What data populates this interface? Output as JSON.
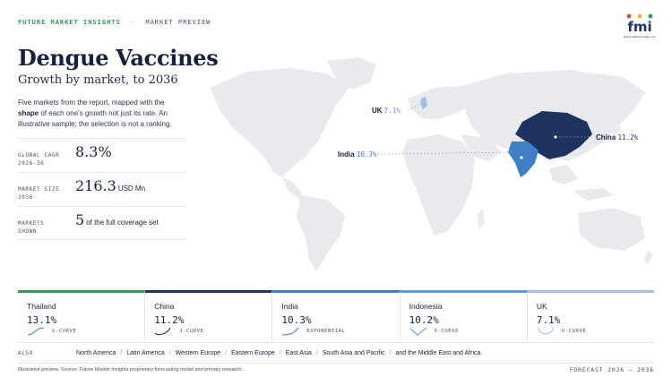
{
  "header": {
    "brand": "FUTURE MARKET INSIGHTS",
    "separator": "·",
    "section": "MARKET PREVIEW",
    "logo_text": "fmi",
    "logo_tagline": "Future Market Insights, Inc."
  },
  "title": "Dengue Vaccines",
  "subtitle": "Growth by market, to 2036",
  "intro": {
    "part1": "Five markets from the report, mapped with the ",
    "bold": "shape",
    "part2": " of each one's growth not just its rate. An illustrative sample; the selection is not a ranking."
  },
  "kpis": [
    {
      "label_line1": "GLOBAL CAGR",
      "label_line2": "2026-36",
      "value": "8.3%",
      "unit": ""
    },
    {
      "label_line1": "MARKET SIZE",
      "label_line2": "2036",
      "value": "216.3",
      "unit": "USD Mn"
    },
    {
      "label_line1": "MARKETS",
      "label_line2": "SHOWN",
      "value": "5",
      "unit": "of the full coverage set"
    }
  ],
  "map": {
    "labels": [
      {
        "country": "UK",
        "rate": "7.1%"
      },
      {
        "country": "India",
        "rate": "10.3%"
      },
      {
        "country": "China",
        "rate": "11.2%"
      }
    ],
    "colors": {
      "land": "#e8eaee",
      "china": "#1d3361",
      "india": "#3f7fc6",
      "uk": "#9dc1e8",
      "leader": "#9aa3b2"
    }
  },
  "markets": [
    {
      "name": "Thailand",
      "cagr": "13.1%",
      "curve": "S-CURVE",
      "color": "#2e9b5a"
    },
    {
      "name": "China",
      "cagr": "11.2%",
      "curve": "J-CURVE",
      "color": "#1d3361"
    },
    {
      "name": "India",
      "cagr": "10.3%",
      "curve": "EXPONENTIAL",
      "color": "#3f7fc6"
    },
    {
      "name": "Indonesia",
      "cagr": "10.2%",
      "curve": "V-CURVE",
      "color": "#5b9bd5"
    },
    {
      "name": "UK",
      "cagr": "7.1%",
      "curve": "U-CURVE",
      "color": "#9dc1e8"
    }
  ],
  "also": {
    "label": "ALSO",
    "regions": [
      "North America",
      "Latin America",
      "Western Europe",
      "Eastern Europe",
      "East Asia",
      "South Asia and Pacific",
      "and the Middle East and Africa."
    ],
    "separator": "/"
  },
  "footer": {
    "source": "Illustrative preview. Source: Future Market Insights proprietary forecasting model and primary research.",
    "forecast": "FORECAST 2026 – 2036"
  }
}
